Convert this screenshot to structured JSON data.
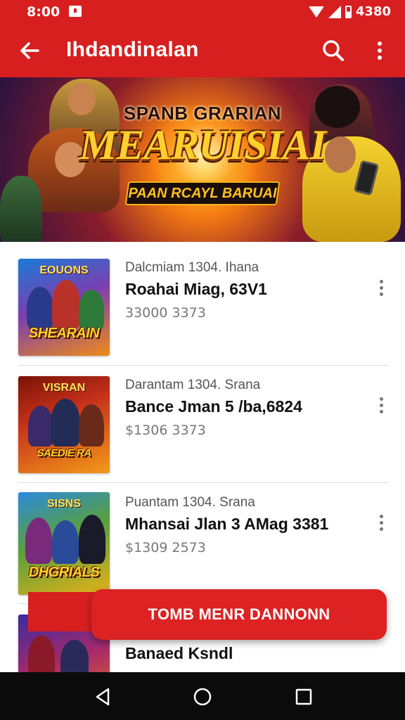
{
  "status_bar": {
    "time": "8:00",
    "battery_level": "4380",
    "icons": [
      "notification-icon",
      "wifi-icon",
      "cell-signal-icon",
      "battery-icon"
    ]
  },
  "app_bar": {
    "title": "Ihdandinalan",
    "icons": [
      "back-arrow-icon",
      "search-icon",
      "more-vert-icon"
    ],
    "color": "#d71f1f"
  },
  "banner": {
    "top_line": "SPANB GRARIAN",
    "title": "MEARUISIAI",
    "subtitle": "PAAN RCAYL BARUAI"
  },
  "list": {
    "items": [
      {
        "meta": "Dalcmiam 1304. Ihana",
        "title": "Roahai Miag, 63V1",
        "sub": "33000 3373",
        "thumb_top": "EOUONS",
        "thumb_label": "SHEARAIN"
      },
      {
        "meta": "Darantam 1304. Srana",
        "title": "Bance Jman 5 /ba,6824",
        "sub": "$1306 3373",
        "thumb_top": "VISRAN",
        "thumb_label": "SAEDIE RA"
      },
      {
        "meta": "Puantam 1304. Srana",
        "title": "Mhansai Jlan 3 AMag 3381",
        "sub": "$1309 2573",
        "thumb_top": "SISNS",
        "thumb_label": "DHGRIALS"
      },
      {
        "meta": "",
        "title": "Banaed Ksndl",
        "sub": "",
        "thumb_top": "",
        "thumb_label": ""
      }
    ]
  },
  "cta": {
    "label": "TOMB MENR DANNONN"
  },
  "nav_bar": {
    "icons": [
      "nav-back-icon",
      "nav-home-icon",
      "nav-recent-icon"
    ]
  }
}
